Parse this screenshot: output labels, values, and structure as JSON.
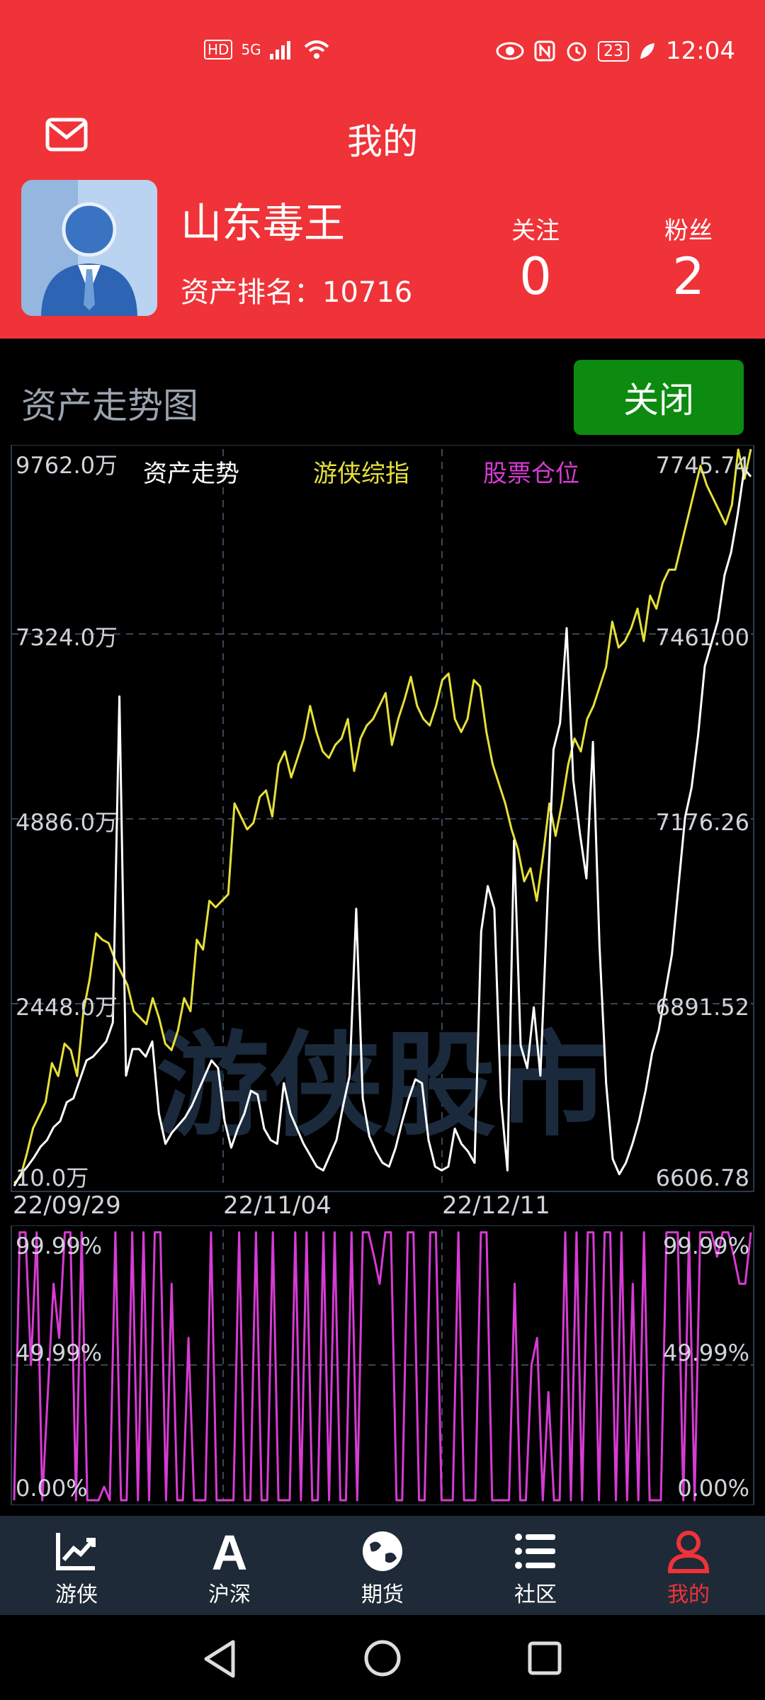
{
  "status": {
    "time": "12:04",
    "battery": "23",
    "network": "5G",
    "hd": "HD"
  },
  "header": {
    "title": "我的",
    "username": "山东毒王",
    "rank_label": "资产排名：",
    "rank_value": "10716",
    "follow_label": "关注",
    "follow_value": "0",
    "fans_label": "粉丝",
    "fans_value": "2"
  },
  "section": {
    "title": "资产走势图",
    "close_label": "关闭"
  },
  "watermark": "游侠股市",
  "chart_data": [
    {
      "type": "line",
      "legend": [
        "资产走势",
        "游侠综指",
        "股票仓位"
      ],
      "left_ticks": [
        "9762.0万",
        "7324.0万",
        "4886.0万",
        "2448.0万",
        "10.0万"
      ],
      "right_ticks": [
        "7745.74",
        "7461.00",
        "7176.26",
        "6891.52",
        "6606.78"
      ],
      "x_labels": [
        "22/09/29",
        "22/11/04",
        "22/12/11"
      ],
      "ylim_left": [
        10.0,
        9762.0
      ],
      "ylim_right": [
        6606.78,
        7745.74
      ],
      "series": [
        {
          "name": "资产走势",
          "color": "#ffffff",
          "axis": "left",
          "values": [
            45,
            200,
            300,
            420,
            560,
            650,
            820,
            900,
            1150,
            1200,
            1450,
            1700,
            1750,
            1850,
            1950,
            2200,
            6500,
            1500,
            1850,
            1850,
            1750,
            1950,
            1000,
            600,
            750,
            850,
            950,
            1100,
            1300,
            1500,
            1700,
            1600,
            900,
            550,
            800,
            1000,
            1300,
            1250,
            800,
            650,
            600,
            1400,
            1000,
            800,
            600,
            450,
            300,
            250,
            450,
            650,
            1100,
            1500,
            3700,
            1200,
            700,
            500,
            350,
            300,
            550,
            900,
            1200,
            1450,
            1400,
            650,
            300,
            250,
            300,
            800,
            600,
            500,
            350,
            3400,
            4000,
            3700,
            1200,
            250,
            4600,
            1900,
            1600,
            2400,
            1500,
            3600,
            5800,
            6150,
            7400,
            5400,
            4700,
            4100,
            5900,
            3200,
            1400,
            400,
            200,
            350,
            600,
            900,
            1300,
            1800,
            2100,
            2600,
            3100,
            4000,
            4900,
            5300,
            6000,
            6900,
            7200,
            7500,
            8100,
            8400,
            8900,
            9500,
            9400
          ]
        },
        {
          "name": "游侠综指",
          "color": "#e6e03a",
          "axis": "right",
          "values": [
            6615,
            6625,
            6660,
            6700,
            6720,
            6740,
            6800,
            6780,
            6830,
            6820,
            6780,
            6880,
            6930,
            7000,
            6990,
            6985,
            6960,
            6940,
            6920,
            6880,
            6870,
            6860,
            6900,
            6870,
            6830,
            6820,
            6850,
            6900,
            6880,
            6990,
            6975,
            7050,
            7040,
            7050,
            7060,
            7200,
            7180,
            7160,
            7170,
            7210,
            7220,
            7180,
            7260,
            7280,
            7240,
            7270,
            7300,
            7350,
            7310,
            7280,
            7270,
            7290,
            7300,
            7330,
            7250,
            7300,
            7320,
            7330,
            7350,
            7370,
            7290,
            7330,
            7360,
            7395,
            7350,
            7330,
            7320,
            7350,
            7390,
            7400,
            7330,
            7310,
            7330,
            7390,
            7380,
            7310,
            7260,
            7230,
            7200,
            7160,
            7130,
            7080,
            7100,
            7050,
            7120,
            7200,
            7150,
            7200,
            7260,
            7300,
            7280,
            7330,
            7350,
            7380,
            7410,
            7480,
            7440,
            7450,
            7470,
            7500,
            7450,
            7520,
            7500,
            7540,
            7560,
            7560,
            7600,
            7640,
            7680,
            7720,
            7690,
            7670,
            7650,
            7630,
            7660,
            7745,
            7700,
            7760
          ]
        },
        {
          "name": "股票仓位",
          "color": "#d63bd3",
          "axis": "pos",
          "values": [
            0,
            99,
            99,
            50,
            99,
            0,
            40,
            80,
            60,
            99,
            99,
            0,
            99,
            0,
            0,
            0,
            5,
            0,
            99,
            0,
            0,
            99,
            0,
            99,
            0,
            99,
            99,
            0,
            80,
            0,
            0,
            60,
            0,
            0,
            0,
            99,
            0,
            0,
            0,
            0,
            99,
            0,
            0,
            99,
            0,
            0,
            99,
            0,
            0,
            0,
            99,
            0,
            99,
            0,
            0,
            99,
            0,
            99,
            0,
            0,
            99,
            0,
            99,
            99,
            90,
            80,
            99,
            99,
            0,
            0,
            99,
            99,
            0,
            0,
            99,
            99,
            0,
            0,
            0,
            99,
            0,
            0,
            0,
            99,
            99,
            0,
            0,
            0,
            0,
            80,
            0,
            0,
            50,
            60,
            0,
            40,
            0,
            0,
            99,
            0,
            99,
            0,
            99,
            99,
            0,
            99,
            99,
            0,
            99,
            0,
            80,
            0,
            99,
            0,
            0,
            0,
            99,
            99,
            99,
            0,
            99,
            0,
            99,
            99,
            99,
            90,
            99,
            99,
            90,
            80,
            80,
            99
          ]
        }
      ],
      "position_ticks": [
        "99.99%",
        "49.99%",
        "0.00%"
      ]
    }
  ],
  "tabs": [
    {
      "label": "游侠",
      "icon": "chart-icon"
    },
    {
      "label": "沪深",
      "icon": "letter-a-icon"
    },
    {
      "label": "期货",
      "icon": "globe-icon"
    },
    {
      "label": "社区",
      "icon": "list-icon"
    },
    {
      "label": "我的",
      "icon": "user-icon"
    }
  ],
  "colors": {
    "brand": "#ef3338",
    "close": "#0c8b10",
    "tabbar": "#1e2a37"
  }
}
